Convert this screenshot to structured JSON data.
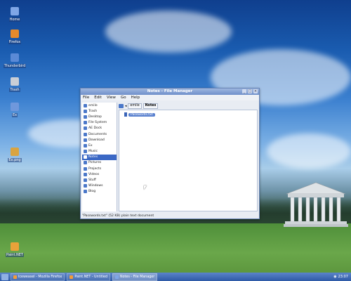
{
  "desktop_icons": [
    {
      "label": "Home",
      "icon": "home-folder-icon"
    },
    {
      "label": "Firefox",
      "icon": "firefox-icon"
    },
    {
      "label": "Thunderbird",
      "icon": "thunderbird-icon"
    },
    {
      "label": "Trash",
      "icon": "trash-icon"
    },
    {
      "label": "Ex",
      "icon": "folder-icon"
    },
    {
      "label": "Ex.png",
      "icon": "image-file-icon"
    },
    {
      "label": "Paint.NET",
      "icon": "paint-icon"
    }
  ],
  "window": {
    "title": "Notes - File Manager",
    "menu": [
      "File",
      "Edit",
      "View",
      "Go",
      "Help"
    ],
    "path": {
      "parent": "emile",
      "current": "Notes"
    },
    "sidebar": [
      {
        "label": "emile",
        "selected": false
      },
      {
        "label": "Trash",
        "selected": false
      },
      {
        "label": "Desktop",
        "selected": false
      },
      {
        "label": "File System",
        "selected": false
      },
      {
        "label": "AE Dock",
        "selected": false
      },
      {
        "label": "Documents",
        "selected": false
      },
      {
        "label": "Download",
        "selected": false
      },
      {
        "label": "Ex",
        "selected": false
      },
      {
        "label": "Music",
        "selected": false
      },
      {
        "label": "Notes",
        "selected": true
      },
      {
        "label": "Pictures",
        "selected": false
      },
      {
        "label": "Projects",
        "selected": false
      },
      {
        "label": "Videos",
        "selected": false
      },
      {
        "label": "Stuff",
        "selected": false
      },
      {
        "label": "Windows",
        "selected": false
      },
      {
        "label": "Blog",
        "selected": false
      }
    ],
    "files": [
      {
        "name": "Passwords.txt"
      }
    ],
    "status": "\"Passwords.txt\" (52 KB) plain text document"
  },
  "taskbar": {
    "buttons": [
      {
        "label": "Iceweasel - Mozilla Firefox",
        "active": false
      },
      {
        "label": "Paint.NET - Untitled",
        "active": false
      },
      {
        "label": "Notes - File Manager",
        "active": true
      }
    ],
    "clock": "23:07"
  }
}
